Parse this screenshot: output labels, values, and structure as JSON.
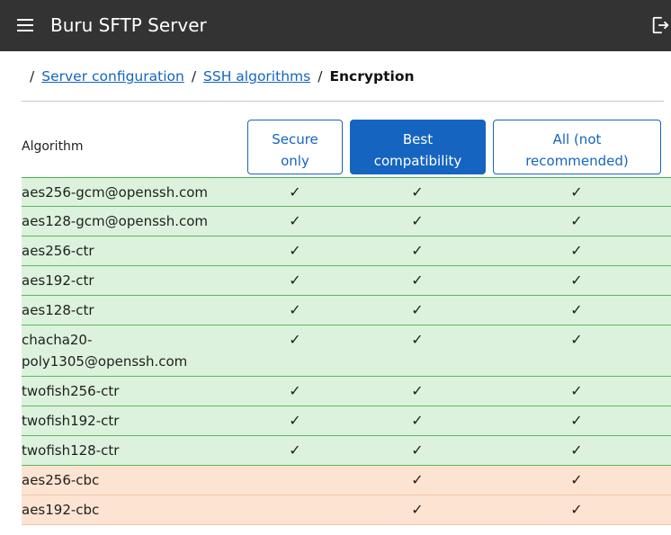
{
  "app": {
    "title": "Buru SFTP Server"
  },
  "breadcrumb": {
    "sep": "/",
    "items": [
      "Server configuration",
      "SSH algorithms"
    ],
    "current": "Encryption"
  },
  "table": {
    "column_label": "Algorithm",
    "modes": [
      {
        "line1": "Secure",
        "line2": "only",
        "active": false
      },
      {
        "line1": "Best",
        "line2": "compatibility",
        "active": true
      },
      {
        "line1": "All (not",
        "line2": "recommended)",
        "active": false
      }
    ],
    "check_glyph": "✓",
    "rows": [
      {
        "name": "aes256-gcm@openssh.com",
        "status": "green",
        "checks": [
          true,
          true,
          true
        ]
      },
      {
        "name": "aes128-gcm@openssh.com",
        "status": "green",
        "checks": [
          true,
          true,
          true
        ]
      },
      {
        "name": "aes256-ctr",
        "status": "green",
        "checks": [
          true,
          true,
          true
        ]
      },
      {
        "name": "aes192-ctr",
        "status": "green",
        "checks": [
          true,
          true,
          true
        ]
      },
      {
        "name": "aes128-ctr",
        "status": "green",
        "checks": [
          true,
          true,
          true
        ]
      },
      {
        "name": "chacha20-poly1305@openssh.com",
        "name_lines": [
          "chacha20-",
          "poly1305@openssh.com"
        ],
        "status": "green",
        "checks": [
          true,
          true,
          true
        ]
      },
      {
        "name": "twofish256-ctr",
        "status": "green",
        "checks": [
          true,
          true,
          true
        ]
      },
      {
        "name": "twofish192-ctr",
        "status": "green",
        "checks": [
          true,
          true,
          true
        ]
      },
      {
        "name": "twofish128-ctr",
        "status": "green",
        "checks": [
          true,
          true,
          true
        ]
      },
      {
        "name": "aes256-cbc",
        "status": "orange",
        "checks": [
          false,
          true,
          true
        ]
      },
      {
        "name": "aes192-cbc",
        "status": "orange",
        "checks": [
          false,
          true,
          true
        ]
      }
    ]
  },
  "colors": {
    "appbar": "#333333",
    "accent": "#1565c0",
    "secure_row": "#dcf2dc",
    "legacy_row": "#fde3d2"
  }
}
